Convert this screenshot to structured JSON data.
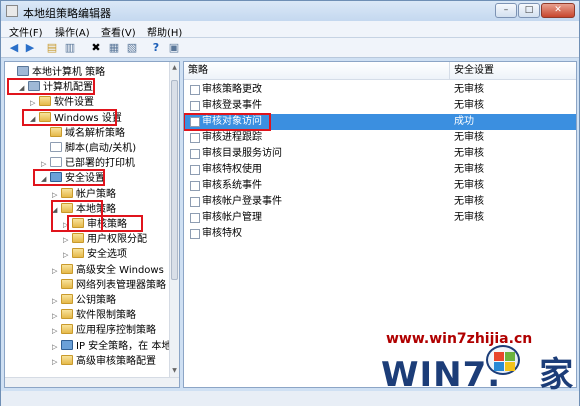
{
  "window": {
    "title": "本地组策略编辑器",
    "minimize": "–",
    "maximize": "□",
    "close": "✕"
  },
  "menu": [
    "文件(F)",
    "操作(A)",
    "查看(V)",
    "帮助(H)"
  ],
  "toolbar_icons": [
    "back-icon",
    "forward-icon",
    "up-folder-icon",
    "show-tree-icon",
    "delete-icon",
    "properties-icon",
    "export-icon",
    "help-icon",
    "view-icon"
  ],
  "tree": [
    {
      "label": "本地计算机 策略",
      "icon": "comp",
      "exp": "",
      "indent": 0
    },
    {
      "label": "计算机配置",
      "icon": "comp",
      "exp": "◢",
      "indent": 1
    },
    {
      "label": "软件设置",
      "icon": "folder",
      "exp": "▷",
      "indent": 2
    },
    {
      "label": "Windows 设置",
      "icon": "folder",
      "exp": "◢",
      "indent": 2
    },
    {
      "label": "域名解析策略",
      "icon": "folder",
      "exp": "",
      "indent": 3
    },
    {
      "label": "脚本(启动/关机)",
      "icon": "doc",
      "exp": "",
      "indent": 3
    },
    {
      "label": "已部署的打印机",
      "icon": "doc",
      "exp": "▷",
      "indent": 3
    },
    {
      "label": "安全设置",
      "icon": "shield",
      "exp": "◢",
      "indent": 3
    },
    {
      "label": "帐户策略",
      "icon": "folder",
      "exp": "▷",
      "indent": 4
    },
    {
      "label": "本地策略",
      "icon": "folder",
      "exp": "◢",
      "indent": 4
    },
    {
      "label": "审核策略",
      "icon": "folder",
      "exp": "▷",
      "indent": 5
    },
    {
      "label": "用户权限分配",
      "icon": "folder",
      "exp": "▷",
      "indent": 5
    },
    {
      "label": "安全选项",
      "icon": "folder",
      "exp": "▷",
      "indent": 5
    },
    {
      "label": "高级安全 Windows",
      "icon": "folder",
      "exp": "▷",
      "indent": 4
    },
    {
      "label": "网络列表管理器策略",
      "icon": "folder",
      "exp": "",
      "indent": 4
    },
    {
      "label": "公钥策略",
      "icon": "folder",
      "exp": "▷",
      "indent": 4
    },
    {
      "label": "软件限制策略",
      "icon": "folder",
      "exp": "▷",
      "indent": 4
    },
    {
      "label": "应用程序控制策略",
      "icon": "folder",
      "exp": "▷",
      "indent": 4
    },
    {
      "label": "IP 安全策略，在 本地",
      "icon": "shield",
      "exp": "▷",
      "indent": 4
    },
    {
      "label": "高级审核策略配置",
      "icon": "folder",
      "exp": "▷",
      "indent": 4
    }
  ],
  "list": {
    "col_policy": "策略",
    "col_setting": "安全设置",
    "rows": [
      {
        "name": "审核策略更改",
        "value": "无审核"
      },
      {
        "name": "审核登录事件",
        "value": "无审核"
      },
      {
        "name": "审核对象访问",
        "value": "成功",
        "selected": true
      },
      {
        "name": "审核进程跟踪",
        "value": "无审核"
      },
      {
        "name": "审核目录服务访问",
        "value": "无审核"
      },
      {
        "name": "审核特权使用",
        "value": "无审核"
      },
      {
        "name": "审核系统事件",
        "value": "无审核"
      },
      {
        "name": "审核帐户登录事件",
        "value": "无审核"
      },
      {
        "name": "审核帐户管理",
        "value": "无审核"
      },
      {
        "name": "审核特权",
        "value": ""
      }
    ]
  },
  "watermark": {
    "url": "www.win7zhijia.cn",
    "logo": "WIN7.",
    "logo_suffix": "家"
  }
}
